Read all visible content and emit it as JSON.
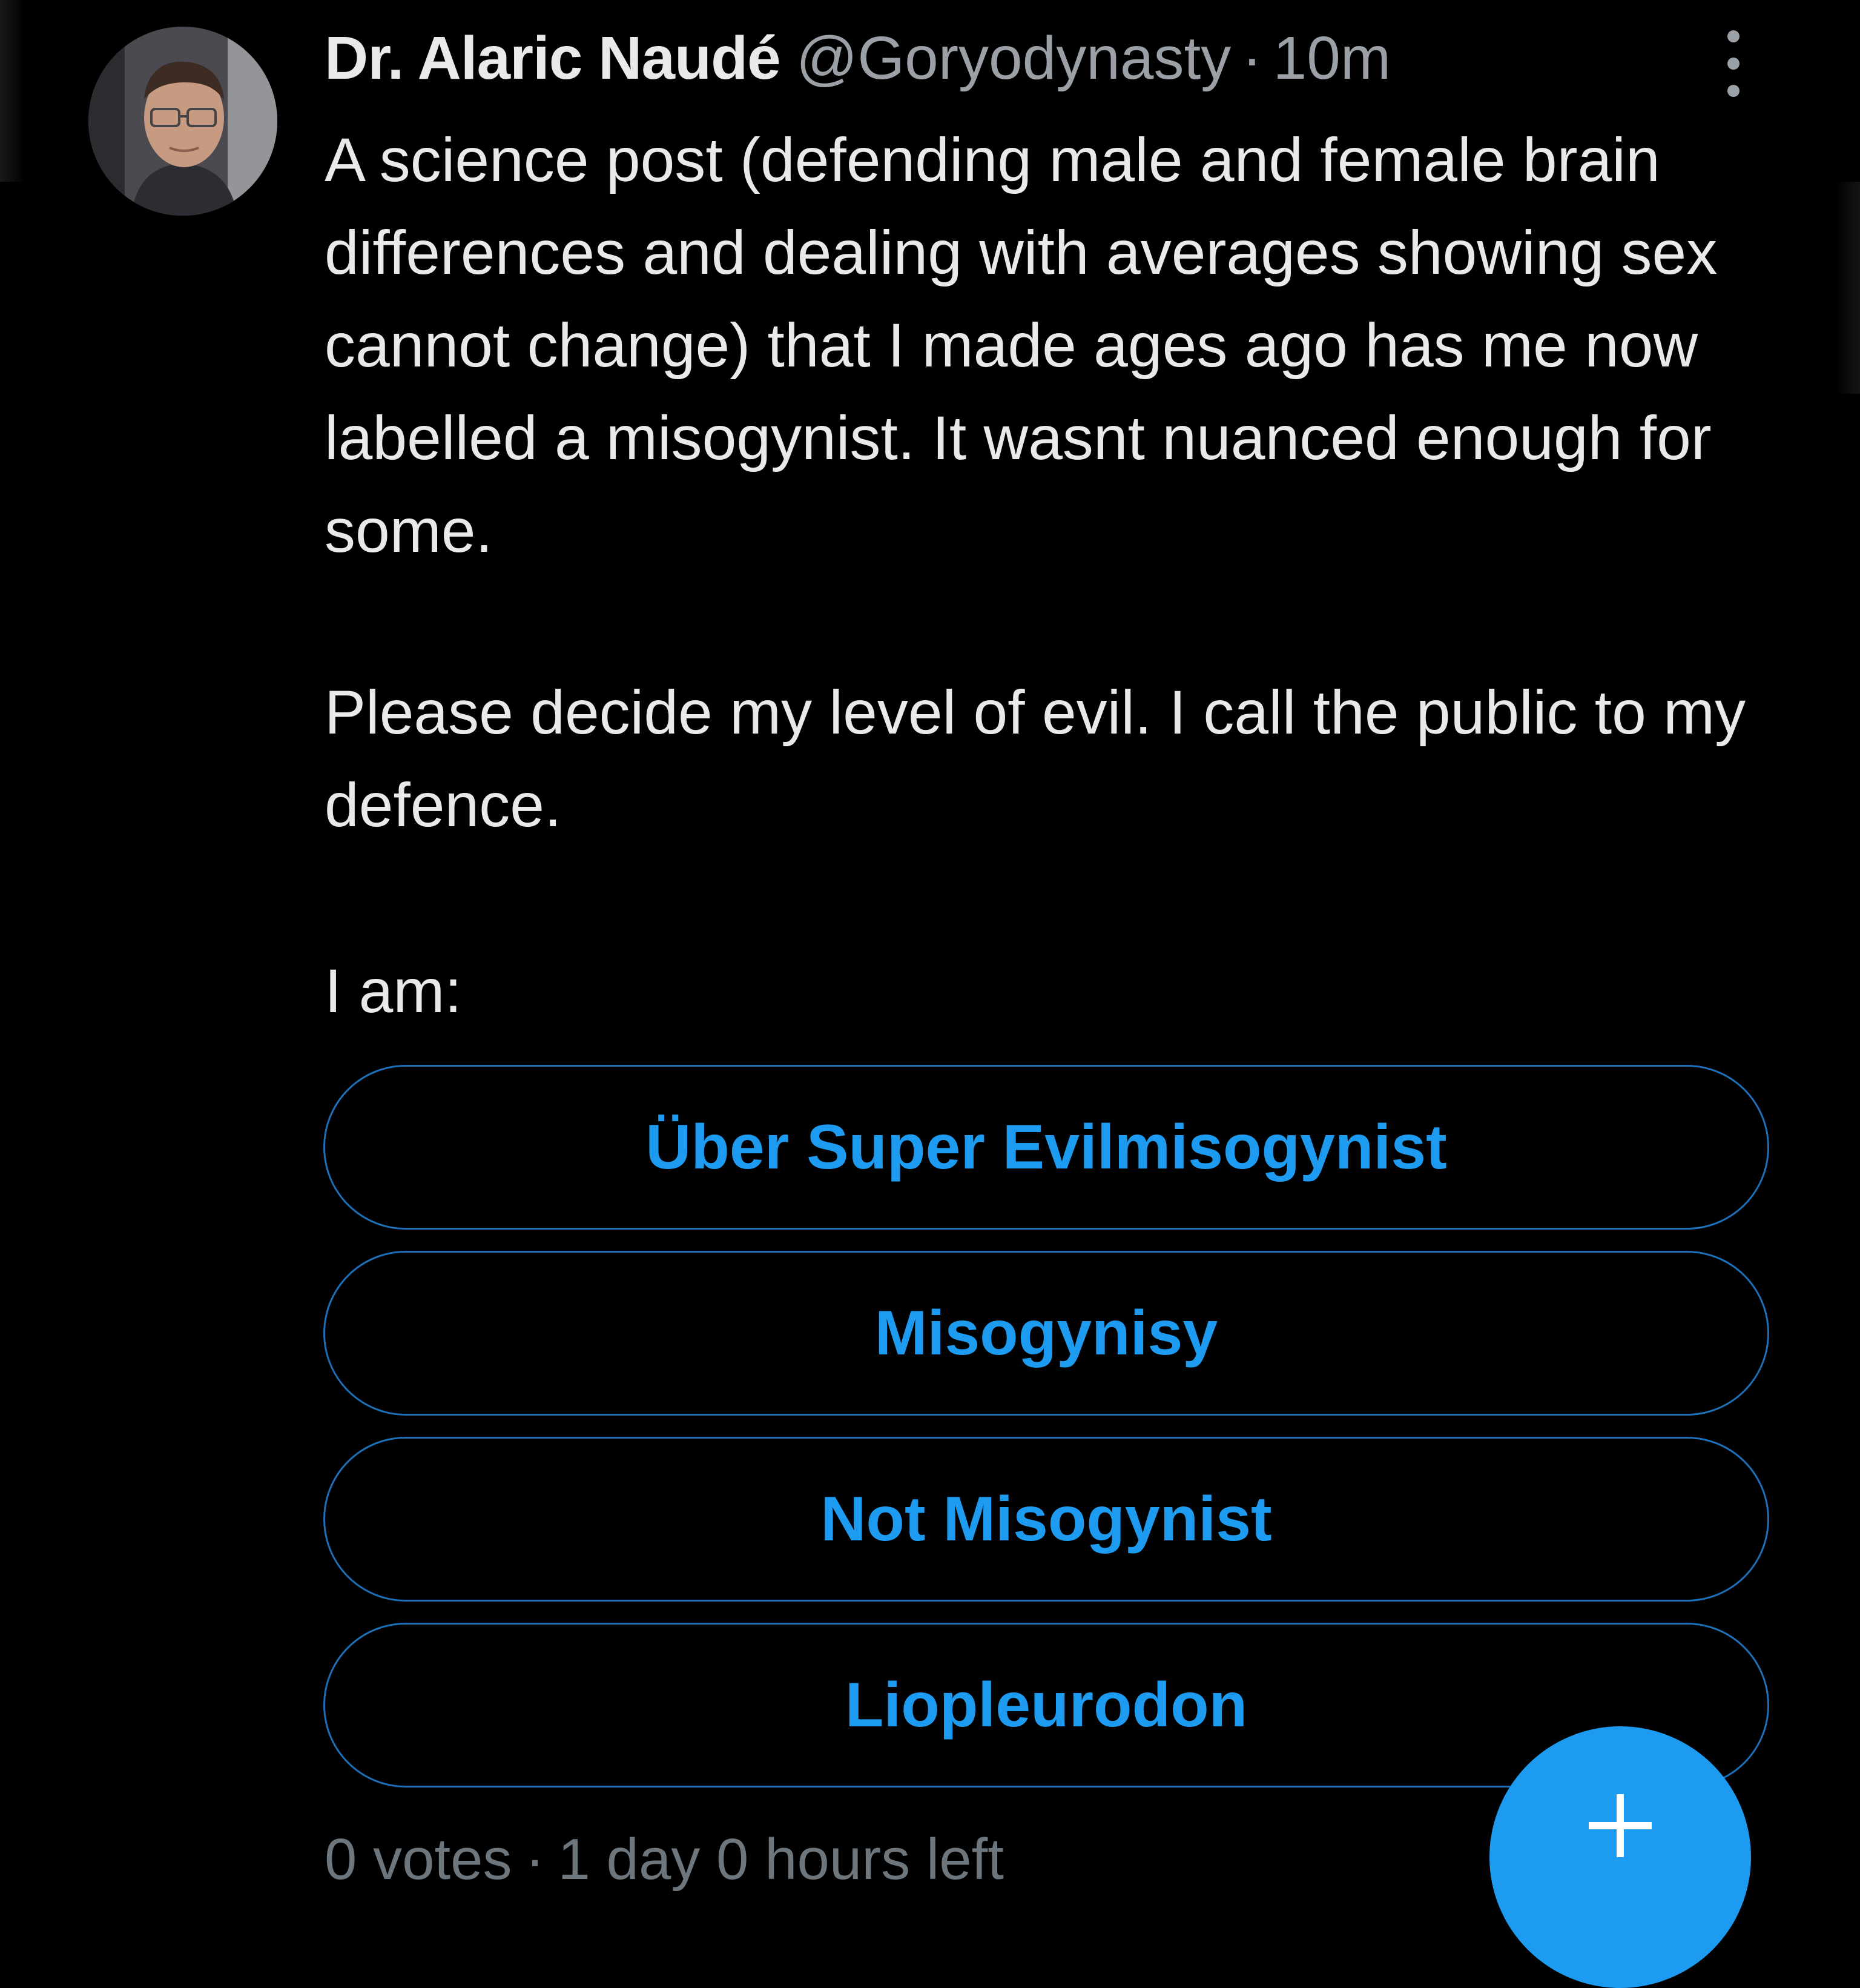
{
  "post": {
    "author_name": "Dr. Alaric Naudé",
    "handle": "@Goryodynasty",
    "separator": "·",
    "timestamp": "10m",
    "paragraphs": [
      "A science post (defending male and female brain differences and dealing with averages showing sex cannot change) that I made ages ago has me now labelled a misogynist. It wasnt nuanced enough for some.",
      "Please decide my level of evil. I call the public to my defence.",
      "I am:"
    ]
  },
  "poll": {
    "options": [
      {
        "label": "Über Super Evilmisogynist"
      },
      {
        "label": "Misogynisy"
      },
      {
        "label": "Not Misogynist"
      },
      {
        "label": "Liopleurodon"
      }
    ],
    "votes_text": "0 votes",
    "separator": "·",
    "time_left_text": "1 day 0 hours left"
  },
  "icons": {
    "more": "more-vertical-icon",
    "compose": "plus-icon"
  },
  "colors": {
    "background": "#000000",
    "text": "#e7e9ea",
    "secondary_text": "#9aa0a6",
    "accent": "#1d9bf0",
    "option_border": "#1d70b8"
  }
}
